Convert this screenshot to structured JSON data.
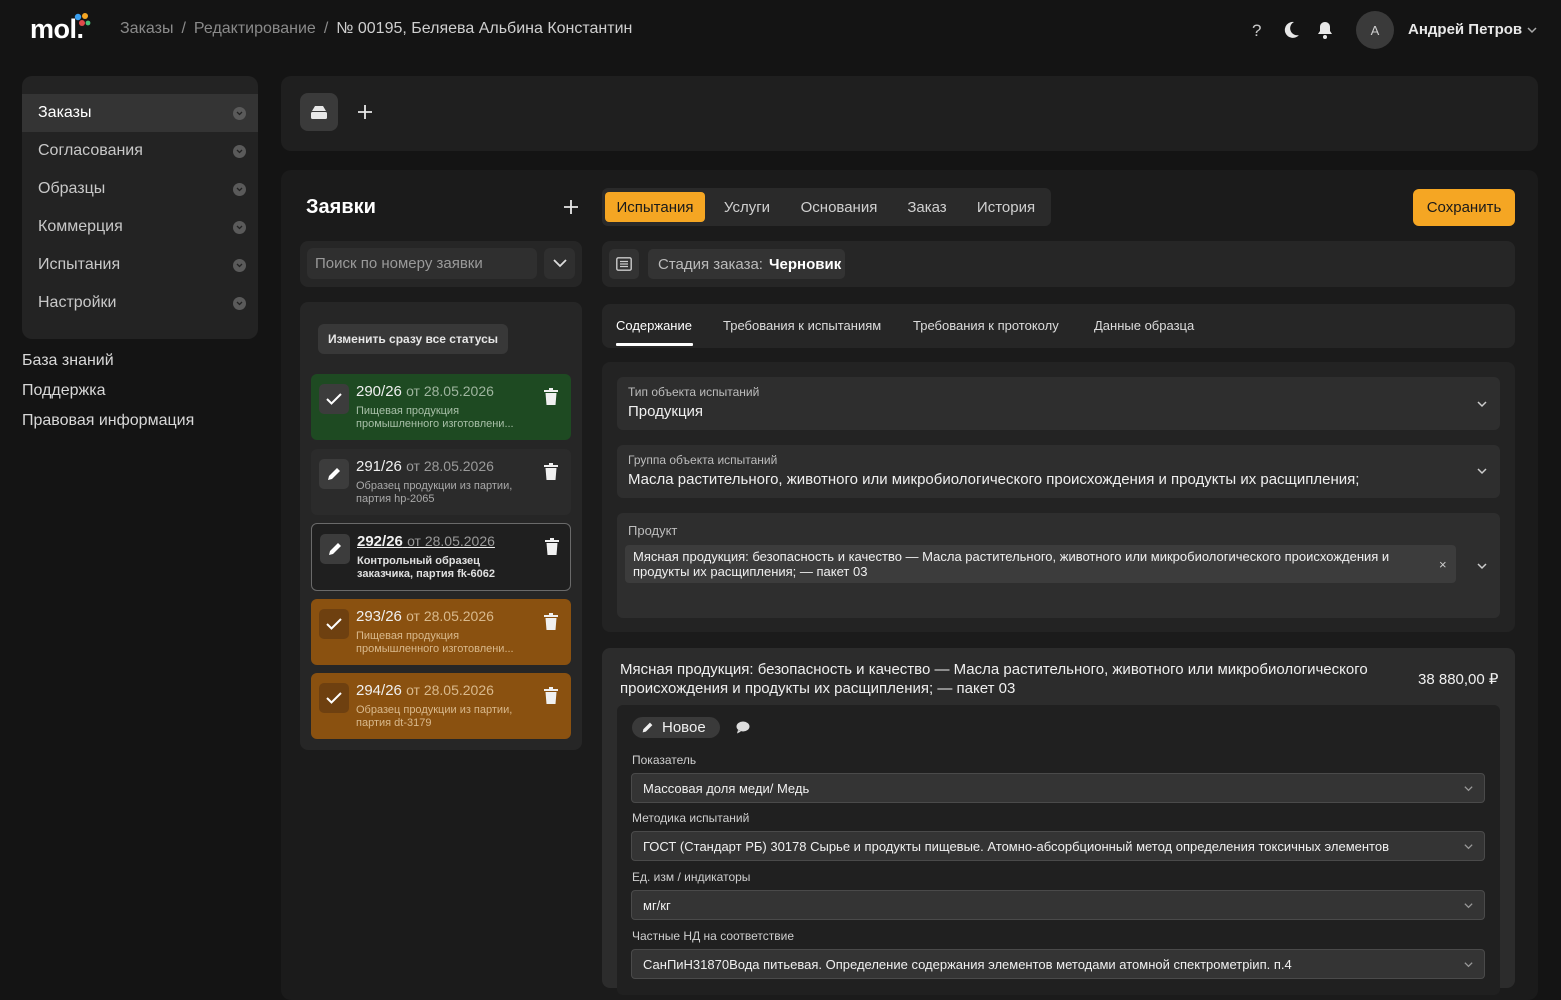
{
  "header": {
    "logo": "mol.",
    "breadcrumbs": [
      "Заказы",
      "Редактирование",
      "№ 00195, Беляева Альбина Константин"
    ],
    "separator": "/",
    "user_initial": "А",
    "user_name": "Андрей Петров",
    "icons": [
      "help-icon",
      "moon-icon",
      "bell-icon"
    ]
  },
  "sidebar": {
    "items": [
      {
        "label": "Заказы",
        "active": true
      },
      {
        "label": "Согласования"
      },
      {
        "label": "Образцы"
      },
      {
        "label": "Коммерция"
      },
      {
        "label": "Испытания"
      },
      {
        "label": "Настройки"
      }
    ],
    "links": [
      "База знаний",
      "Поддержка",
      "Правовая информация"
    ]
  },
  "requests": {
    "title": "Заявки",
    "search_placeholder": "Поиск по номеру заявки",
    "change_all_label": "Изменить сразу все статусы",
    "items": [
      {
        "number": "290/26",
        "date": "от 28.05.2026",
        "desc": "Пищевая продукция промышленного изготовлени...",
        "status": "green",
        "icon": "check"
      },
      {
        "number": "291/26",
        "date": "от 28.05.2026",
        "desc": "Образец продукции из партии, партия hp-2065",
        "status": "gray",
        "icon": "pencil"
      },
      {
        "number": "292/26",
        "date": "от 28.05.2026",
        "desc": "Контрольный образец заказчика, партия fk-6062",
        "status": "selected",
        "icon": "pencil"
      },
      {
        "number": "293/26",
        "date": "от 28.05.2026",
        "desc": "Пищевая продукция промышленного изготовлени...",
        "status": "orange",
        "icon": "check"
      },
      {
        "number": "294/26",
        "date": "от 28.05.2026",
        "desc": "Образец продукции из партии, партия dt-3179",
        "status": "orange",
        "icon": "check"
      }
    ]
  },
  "tabs": {
    "items": [
      "Испытания",
      "Услуги",
      "Основания",
      "Заказ",
      "История"
    ],
    "active": "Испытания",
    "save_label": "Сохранить"
  },
  "stage": {
    "label": "Стадия заказа:",
    "value": "Черновик"
  },
  "subtabs": {
    "items": [
      "Содержание",
      "Требования к испытаниям",
      "Требования к протоколу",
      "Данные образца"
    ],
    "active": "Содержание"
  },
  "form": {
    "object_type_label": "Тип объекта испытаний",
    "object_type_value": "Продукция",
    "object_group_label": "Группа объекта испытаний",
    "object_group_value": "Масла растительного, животного или микробиологического происхождения и продукты их расщипления;",
    "product_label": "Продукт",
    "product_tag": "Мясная продукция: безопасность и качество — Масла растительного, животного или микробиологического происхождения и продукты их расщипления; — пакет 03",
    "product_tag_remove": "×"
  },
  "test_block": {
    "title": "Мясная продукция: безопасность и качество — Масла растительного, животного или микробиологического происхождения и продукты их расщипления; — пакет 03",
    "price": "38 880,00 ₽",
    "status": "Новое",
    "indicator_label": "Показатель",
    "indicator_value": "Массовая доля меди/ Медь",
    "method_label": "Методика испытаний",
    "method_value": "ГОСТ (Стандарт РБ) 30178 Сырье и продукты пищевые. Атомно-абсорбционный метод определения токсичных элементов",
    "unit_label": "Ед. изм / индикаторы",
    "unit_value": "мг/кг",
    "nd_label": "Частные НД на соответствие",
    "nd_value": "СанПиН31870Вода питьевая. Определение содержания элементов методами атомной спектрометрiип. п.4"
  },
  "colors": {
    "accent": "#f5a623",
    "success": "#1e4a22",
    "warning": "#8a5110",
    "background": "#141414"
  }
}
